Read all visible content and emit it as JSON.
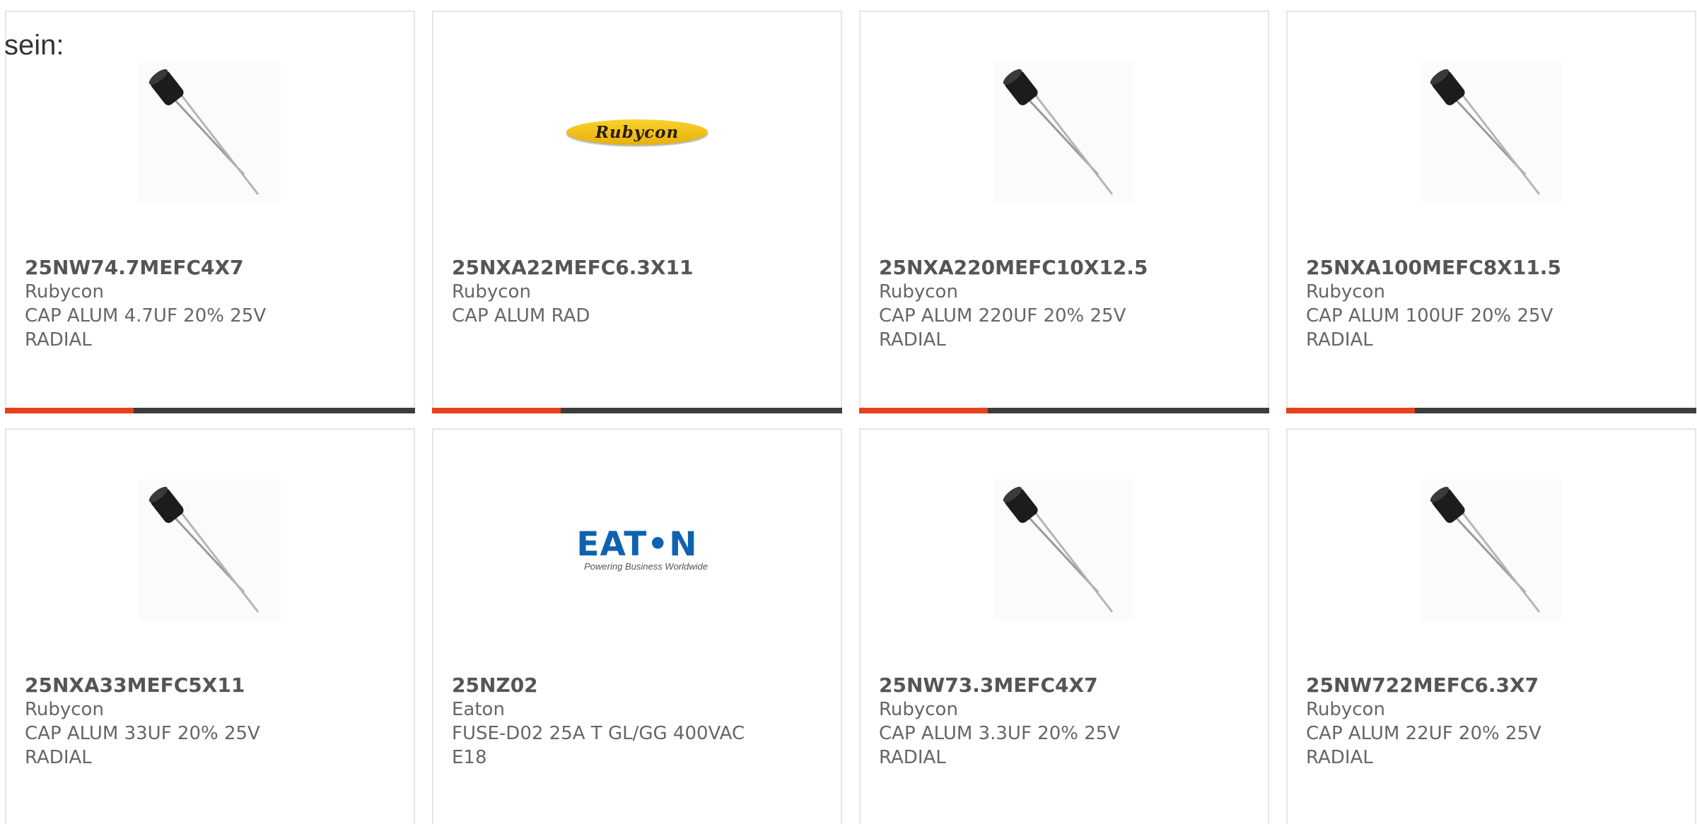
{
  "intro_text": "sein:",
  "products": [
    {
      "part_number": "25NW74.7MEFC4X7",
      "manufacturer": "Rubycon",
      "description": "CAP ALUM 4.7UF 20% 25V RADIAL",
      "image": "capacitor-photo"
    },
    {
      "part_number": "25NXA22MEFC6.3X11",
      "manufacturer": "Rubycon",
      "description": "CAP ALUM RAD",
      "image": "rubycon-logo",
      "logo_text": "Rubycon"
    },
    {
      "part_number": "25NXA220MEFC10X12.5",
      "manufacturer": "Rubycon",
      "description": "CAP ALUM 220UF 20% 25V RADIAL",
      "image": "capacitor-photo"
    },
    {
      "part_number": "25NXA100MEFC8X11.5",
      "manufacturer": "Rubycon",
      "description": "CAP ALUM 100UF 20% 25V RADIAL",
      "image": "capacitor-photo"
    },
    {
      "part_number": "25NXA33MEFC5X11",
      "manufacturer": "Rubycon",
      "description": "CAP ALUM 33UF 20% 25V RADIAL",
      "image": "capacitor-photo"
    },
    {
      "part_number": "25NZ02",
      "manufacturer": "Eaton",
      "description": "FUSE-D02 25A T GL/GG 400VAC E18",
      "image": "eaton-logo",
      "logo_text": "EAT•N",
      "logo_tagline": "Powering Business Worldwide"
    },
    {
      "part_number": "25NW73.3MEFC4X7",
      "manufacturer": "Rubycon",
      "description": "CAP ALUM 3.3UF 20% 25V RADIAL",
      "image": "capacitor-photo"
    },
    {
      "part_number": "25NW722MEFC6.3X7",
      "manufacturer": "Rubycon",
      "description": "CAP ALUM 22UF 20% 25V RADIAL",
      "image": "capacitor-photo"
    }
  ],
  "colors": {
    "accent": "#e8401c",
    "bar_dark": "#3d3d3d",
    "card_border": "#e6e6e6",
    "text": "#666666",
    "eaton_blue": "#0f62b0",
    "rubycon_yellow": "#f2c418"
  }
}
